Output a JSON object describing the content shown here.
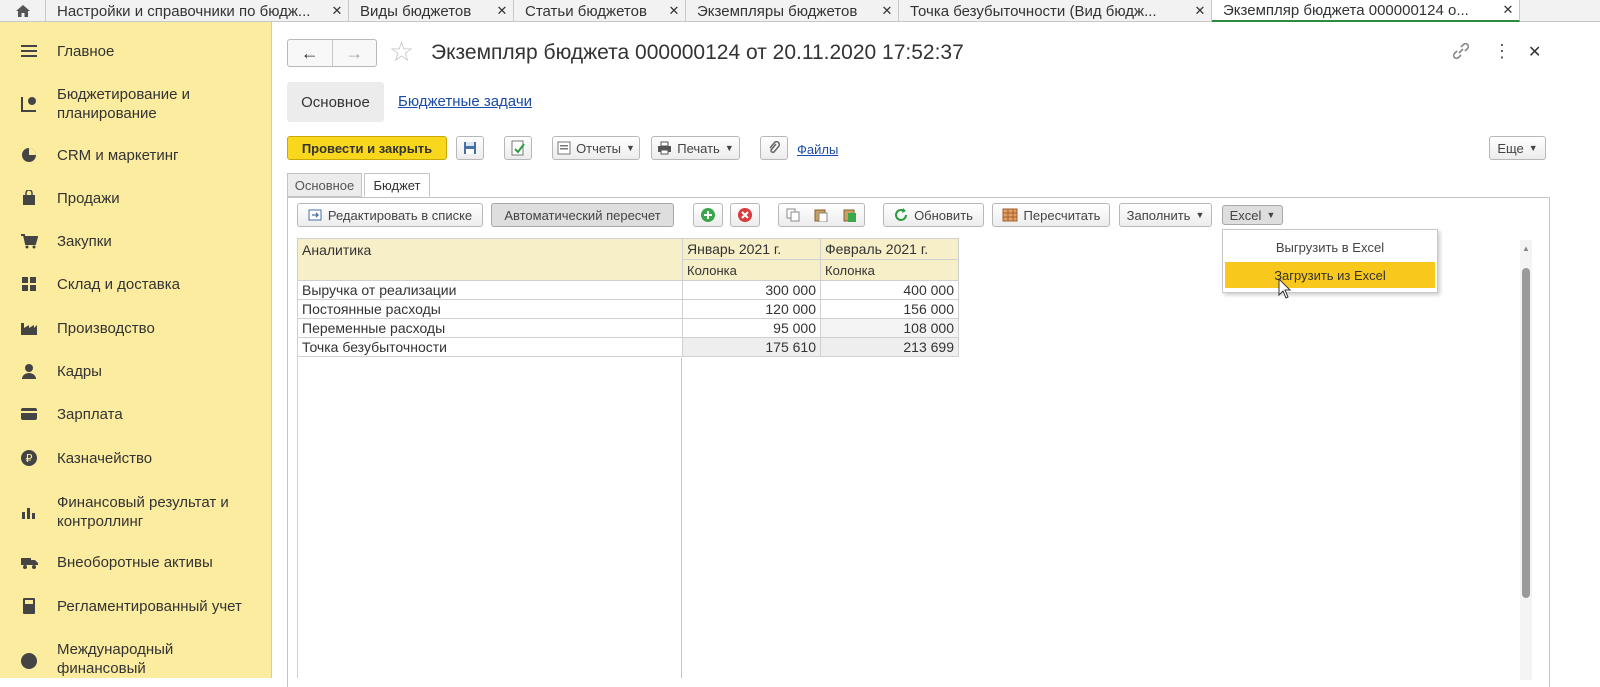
{
  "tabs": [
    {
      "label": "Настройки и справочники по бюдж..."
    },
    {
      "label": "Виды  бюджетов"
    },
    {
      "label": "Статьи бюджетов"
    },
    {
      "label": "Экземпляры бюджетов"
    },
    {
      "label": "Точка безубыточности (Вид бюдж..."
    },
    {
      "label": "Экземпляр бюджета 000000124 о..."
    }
  ],
  "sidebar": {
    "items": [
      {
        "label": "Главное",
        "icon": "menu-icon"
      },
      {
        "label": "Бюджетирование и планирование",
        "icon": "budget-icon"
      },
      {
        "label": "CRM и маркетинг",
        "icon": "pie-chart-icon"
      },
      {
        "label": "Продажи",
        "icon": "bag-icon"
      },
      {
        "label": "Закупки",
        "icon": "cart-icon"
      },
      {
        "label": "Склад и доставка",
        "icon": "warehouse-icon"
      },
      {
        "label": "Производство",
        "icon": "factory-icon"
      },
      {
        "label": "Кадры",
        "icon": "person-icon"
      },
      {
        "label": "Зарплата",
        "icon": "card-icon"
      },
      {
        "label": "Казначейство",
        "icon": "ruble-icon"
      },
      {
        "label": "Финансовый результат и контроллинг",
        "icon": "bar-chart-icon"
      },
      {
        "label": "Внеоборотные активы",
        "icon": "truck-icon"
      },
      {
        "label": "Регламентированный учет",
        "icon": "calculator-icon"
      },
      {
        "label": "Международный финансовый",
        "icon": "globe-icon"
      }
    ]
  },
  "header": {
    "title": "Экземпляр бюджета 000000124 от 20.11.2020 17:52:37",
    "back": "←",
    "forward": "→",
    "star": "☆",
    "more": "⋮",
    "close": "✕"
  },
  "formtabs": {
    "main": "Основное",
    "tasks": "Бюджетные задачи"
  },
  "toolbar": {
    "post_close": "Провести и закрыть",
    "reports": "Отчеты",
    "print": "Печать",
    "files": "Файлы",
    "more": "Еще"
  },
  "pagetabs": {
    "main": "Основное",
    "budget": "Бюджет"
  },
  "panel_toolbar": {
    "edit_list": "Редактировать в списке",
    "auto_recalc": "Автоматический пересчет",
    "refresh": "Обновить",
    "recalc": "Пересчитать",
    "fill": "Заполнить",
    "excel": "Excel"
  },
  "dropdown": {
    "export": "Выгрузить в Excel",
    "import": "Загрузить из Excel"
  },
  "table": {
    "header_analytics": "Аналитика",
    "columns": [
      "Январь 2021 г.",
      "Февраль 2021 г."
    ],
    "subheaders": [
      "Колонка",
      "Колонка"
    ],
    "rows": [
      {
        "label": "Выручка от реализации",
        "values": [
          "300 000",
          "400 000"
        ]
      },
      {
        "label": "Постоянные расходы",
        "values": [
          "120 000",
          "156 000"
        ]
      },
      {
        "label": "Переменные расходы",
        "values": [
          "95 000",
          "108 000"
        ]
      },
      {
        "label": "Точка безубыточности",
        "values": [
          "175 610",
          "213 699"
        ]
      }
    ]
  },
  "colors": {
    "accent_yellow": "#f8d71c",
    "sidebar_bg": "#fbeca0",
    "active_tab_line": "#2d8a3e",
    "link": "#1a4ba8"
  }
}
